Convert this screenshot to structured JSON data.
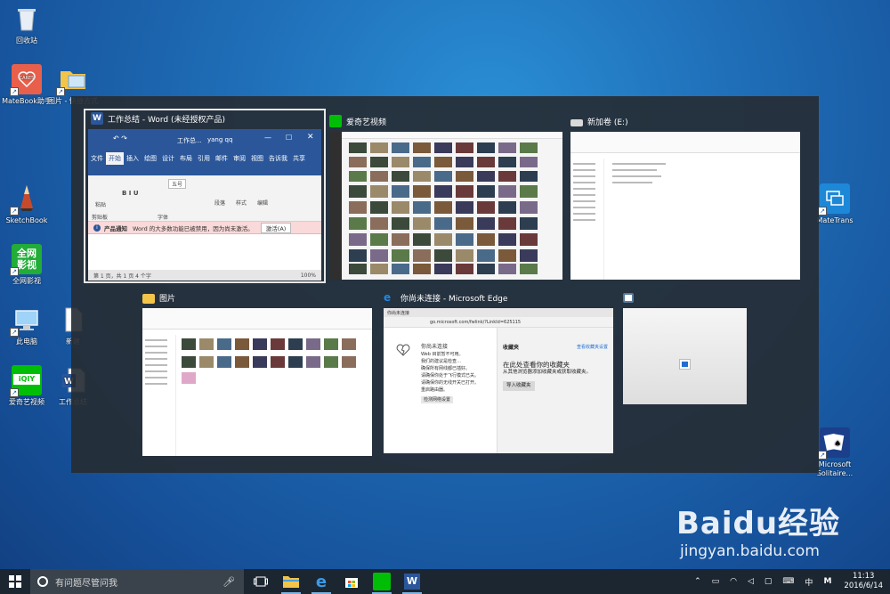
{
  "desktop": {
    "icons": [
      {
        "label": "回收站"
      },
      {
        "label": "MateBook助手"
      },
      {
        "label": "图片 - 快捷方式"
      },
      {
        "label": "SketchBook"
      },
      {
        "label": "全网影视"
      },
      {
        "label": "此电脑"
      },
      {
        "label": "新建"
      },
      {
        "label": "爱奇艺视频"
      },
      {
        "label": "工作总结"
      },
      {
        "label": "MateTrans"
      },
      {
        "label": "Microsoft Solitaire..."
      }
    ],
    "tile_texts": {
      "matebook": "CARES",
      "quanwang": "全网\n影视",
      "iqiyi": "iQIY"
    }
  },
  "task_view": {
    "windows": [
      {
        "title": "工作总结 - Word (未经授权产品)",
        "icon": "word-icon"
      },
      {
        "title": "爱奇艺视频",
        "icon": "iqiyi-icon"
      },
      {
        "title": "新加卷 (E:)",
        "icon": "drive-icon"
      },
      {
        "title": "图片",
        "icon": "folder-icon"
      },
      {
        "title": "你尚未连接 - Microsoft Edge",
        "icon": "edge-icon"
      },
      {
        "title": "",
        "icon": "app-icon"
      }
    ],
    "word": {
      "doc_title": "工作总...",
      "user": "yang qq",
      "tabs": [
        "文件",
        "开始",
        "插入",
        "绘图",
        "设计",
        "布局",
        "引用",
        "邮件",
        "审阅",
        "视图",
        "告诉我",
        "共享"
      ],
      "groups": [
        "剪贴板",
        "字体",
        "段落",
        "样式",
        "编辑"
      ],
      "paste_label": "粘贴",
      "font_size": "五号",
      "banner_label": "产品通知",
      "banner_text": "Word 的大多数功能已被禁用，因为尚未激活。",
      "banner_button": "激活(A)",
      "status": "第 1 页，共 1 页    4 个字",
      "zoom": "100%"
    },
    "edge": {
      "tab_label": "你尚未连接",
      "url": "go.microsoft.com/fwlink/?LinkId=625115",
      "error_title": "你尚未连接",
      "error_sub": "Web 目前暂不可用。",
      "error_hint": "我们的建议是检查…",
      "error_items": [
        "确保所有网线都已插好。",
        "请确保你处于飞行模式已关。",
        "请确保你的无线开关已打开。",
        "重启路由器。"
      ],
      "error_button": "检测网络设置",
      "fav_heading": "收藏夹",
      "fav_link": "查看收藏夹设置",
      "fav_title": "在此处查看你的收藏夹",
      "fav_sub": "从其他浏览器添加收藏夹或获取收藏夹。",
      "fav_button": "导入收藏夹"
    }
  },
  "taskbar": {
    "search_placeholder": "有问题尽管问我",
    "ime": "中",
    "ime2": "M",
    "time": "11:13",
    "date": "2016/6/14"
  },
  "watermark": {
    "brand": "Baidu经验",
    "url": "jingyan.baidu.com"
  }
}
